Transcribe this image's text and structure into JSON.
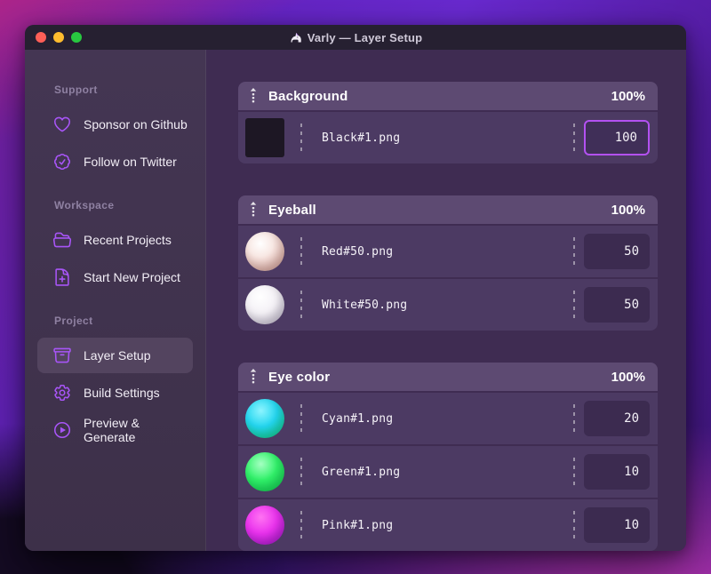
{
  "window": {
    "title": "Varly — Layer Setup",
    "app_icon": "unicorn-icon",
    "traffic_lights": {
      "close": "#ff5f57",
      "minimize": "#febc2e",
      "zoom": "#28c840"
    }
  },
  "colors": {
    "accent": "#a855f7",
    "focus_ring": "#b351f1",
    "group_header": "#5d4a72",
    "row": "#4c3a63",
    "main_bg": "#3f2c52"
  },
  "sidebar": {
    "sections": [
      {
        "label": "Support",
        "items": [
          {
            "icon": "heart-icon",
            "label": "Sponsor on Github",
            "selected": false
          },
          {
            "icon": "badge-check-icon",
            "label": "Follow on Twitter",
            "selected": false
          }
        ]
      },
      {
        "label": "Workspace",
        "items": [
          {
            "icon": "folder-open-icon",
            "label": "Recent Projects",
            "selected": false
          },
          {
            "icon": "document-plus-icon",
            "label": "Start New Project",
            "selected": false
          }
        ]
      },
      {
        "label": "Project",
        "items": [
          {
            "icon": "archive-box-icon",
            "label": "Layer Setup",
            "selected": true
          },
          {
            "icon": "gear-icon",
            "label": "Build Settings",
            "selected": false
          },
          {
            "icon": "play-circle-icon",
            "label": "Preview & Generate",
            "selected": false
          }
        ]
      }
    ]
  },
  "layers": {
    "groups": [
      {
        "name": "Background",
        "weight": "100%",
        "items": [
          {
            "file": "Black#1.png",
            "value": "100",
            "thumb": "black-square",
            "focused": true
          }
        ]
      },
      {
        "name": "Eyeball",
        "weight": "100%",
        "items": [
          {
            "file": "Red#50.png",
            "value": "50",
            "thumb": "red-sphere",
            "focused": false
          },
          {
            "file": "White#50.png",
            "value": "50",
            "thumb": "white-sphere",
            "focused": false
          }
        ]
      },
      {
        "name": "Eye color",
        "weight": "100%",
        "items": [
          {
            "file": "Cyan#1.png",
            "value": "20",
            "thumb": "cyan-sphere",
            "focused": false
          },
          {
            "file": "Green#1.png",
            "value": "10",
            "thumb": "green-sphere",
            "focused": false
          },
          {
            "file": "Pink#1.png",
            "value": "10",
            "thumb": "pink-sphere",
            "focused": false
          }
        ]
      }
    ]
  }
}
